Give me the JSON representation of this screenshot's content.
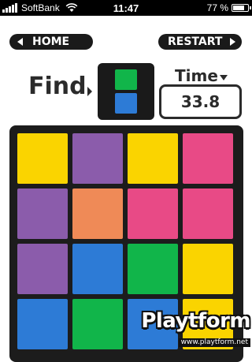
{
  "status_bar": {
    "carrier": "SoftBank",
    "time": "11:47",
    "battery_text": "77 %",
    "battery_level": 0.77,
    "wifi_icon": "wifi-icon"
  },
  "header": {
    "home_label": "HOME",
    "restart_label": "RESTART"
  },
  "target": {
    "label": "Find",
    "swatches": [
      "#11b54a",
      "#2d7bd6"
    ]
  },
  "timer": {
    "label": "Time",
    "value": "33.8"
  },
  "board": {
    "rows": [
      [
        "#fad400",
        "#8b5cab",
        "#fad400",
        "#e84a86"
      ],
      [
        "#8b5cab",
        "#ef8a57",
        "#e84a86",
        "#e84a86"
      ],
      [
        "#8b5cab",
        "#2d7bd6",
        "#11b54a",
        "#fad400"
      ],
      [
        "#2d7bd6",
        "#11b54a",
        "#2d7bd6",
        "#fad400"
      ]
    ]
  },
  "watermark": {
    "logo": "Playtform",
    "url": "www.playtform.net"
  }
}
